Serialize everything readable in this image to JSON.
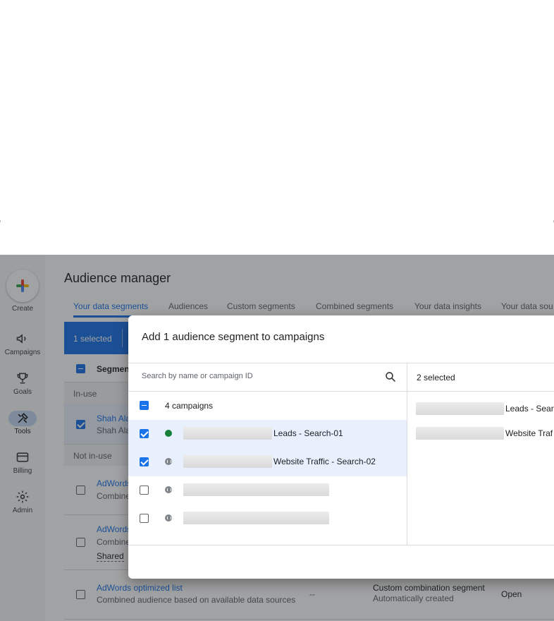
{
  "sidebar": {
    "create_label": "Create",
    "items": [
      {
        "label": "Campaigns",
        "icon": "megaphone-icon"
      },
      {
        "label": "Goals",
        "icon": "trophy-icon"
      },
      {
        "label": "Tools",
        "icon": "tools-icon",
        "active": true
      },
      {
        "label": "Billing",
        "icon": "credit-card-icon"
      },
      {
        "label": "Admin",
        "icon": "gear-icon"
      }
    ]
  },
  "header": {
    "title": "Audience manager",
    "tabs": [
      "Your data segments",
      "Audiences",
      "Custom segments",
      "Combined segments",
      "Your data insights",
      "Your data sou"
    ]
  },
  "selection_bar": {
    "label": "1 selected"
  },
  "table": {
    "header_col": "Segment",
    "section_in_use": "In-use",
    "section_not_in_use": "Not in-use",
    "rows": [
      {
        "name": "Shah Ala",
        "sub": "Shah Ala",
        "checked": true
      },
      {
        "name": "AdWords",
        "sub": "Combine",
        "checked": false
      },
      {
        "name": "AdWords",
        "sub": "Combine",
        "extra": "Shared",
        "checked": false
      },
      {
        "name": "AdWords optimized list",
        "sub": "Combined audience based on available data sources",
        "size": "--",
        "type": "Custom combination segment",
        "type_sub": "Automatically created",
        "status": "Open",
        "checked": false
      }
    ]
  },
  "dialog": {
    "title": "Add 1 audience segment to campaigns",
    "search_placeholder": "Search by name or campaign ID",
    "count_label": "4 campaigns",
    "campaigns": [
      {
        "name": "Leads - Search-01",
        "checked": true,
        "status": "enabled"
      },
      {
        "name": "Website Traffic - Search-02",
        "checked": true,
        "status": "paused"
      },
      {
        "name": "",
        "checked": false,
        "status": "paused"
      },
      {
        "name": "",
        "checked": false,
        "status": "paused"
      }
    ],
    "selected_label": "2 selected",
    "selected": [
      "Leads - Searc",
      "Website Traf"
    ]
  },
  "colors": {
    "accent": "#1a73e8",
    "enabled": "#188038",
    "paused": "#80868b",
    "selected_row": "#e8f0fe"
  }
}
